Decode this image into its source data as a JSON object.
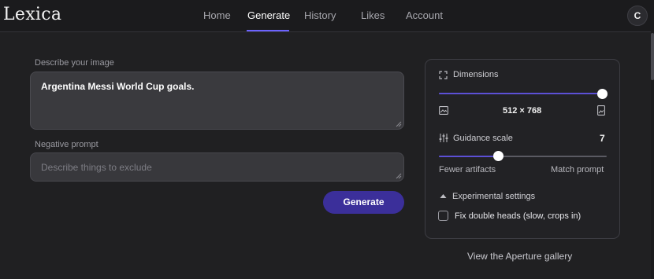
{
  "brand": {
    "logo": "Lexica"
  },
  "nav": {
    "items": [
      {
        "label": "Home",
        "active": false
      },
      {
        "label": "Generate",
        "active": true
      },
      {
        "label": "History",
        "active": false
      },
      {
        "label": "Likes",
        "active": false
      },
      {
        "label": "Account",
        "active": false
      }
    ],
    "avatar_initial": "C"
  },
  "form": {
    "describe_label": "Describe your image",
    "prompt_value": "Argentina Messi World Cup goals.",
    "negative_label": "Negative prompt",
    "negative_placeholder": "Describe things to exclude",
    "generate_label": "Generate"
  },
  "settings": {
    "dimensions_label": "Dimensions",
    "dimensions_value": "512 × 768",
    "dimensions_slider": 1.0,
    "guidance_label": "Guidance scale",
    "guidance_value": "7",
    "guidance_slider": 0.35,
    "guidance_min_label": "Fewer artifacts",
    "guidance_max_label": "Match prompt",
    "experimental_label": "Experimental settings",
    "fix_heads_label": "Fix double heads (slow, crops in)",
    "fix_heads_checked": false
  },
  "footer": {
    "gallery_link": "View the Aperture gallery"
  },
  "colors": {
    "accent": "#5c50d6",
    "button": "#3b2f9a",
    "background": "#202022"
  }
}
